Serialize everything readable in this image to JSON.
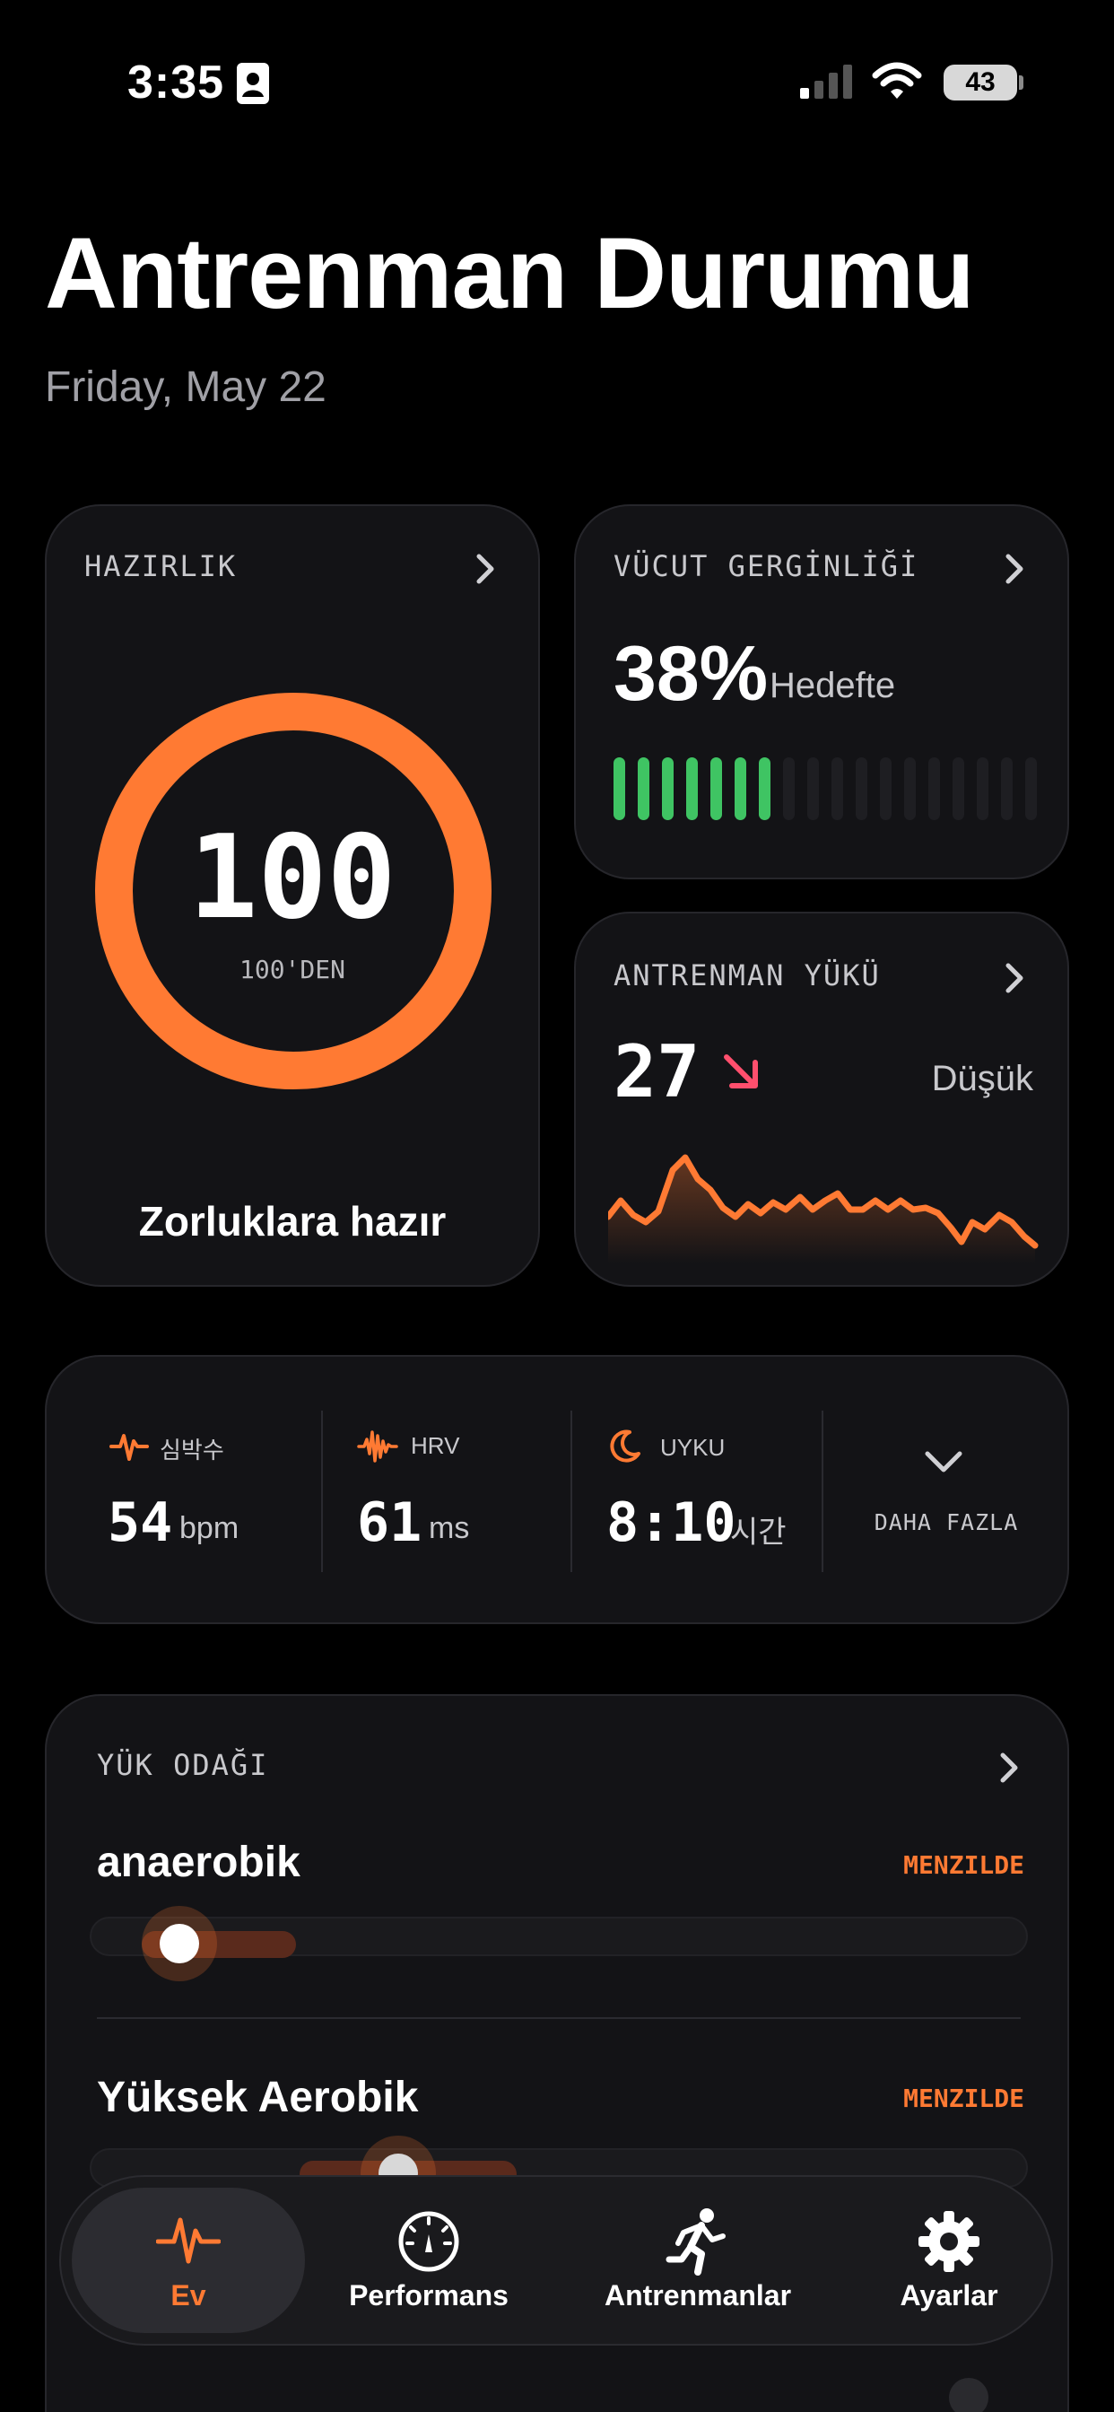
{
  "status_bar": {
    "time": "3:35",
    "battery": "43"
  },
  "header": {
    "title": "Antrenman Durumu",
    "date": "Friday, May 22"
  },
  "readiness": {
    "label": "HAZIRLIK",
    "value": "100",
    "caption": "100'DEN",
    "footer": "Zorluklara hazır",
    "level": 1.0,
    "color": "#ff7a33"
  },
  "body_strain": {
    "label": "VÜCUT GERGİNLİĞİ",
    "value": "38%",
    "status": "Hedefte",
    "filled_segments": 7,
    "total_segments": 18,
    "color": "#3fc463"
  },
  "training_load": {
    "label": "ANTRENMAN YÜKÜ",
    "value": "27",
    "status": "Düşük",
    "trend": "down",
    "trend_color": "#ff4f6d"
  },
  "stats": {
    "heart_rate": {
      "label": "심박수",
      "value": "54",
      "unit": "bpm"
    },
    "hrv": {
      "label": "HRV",
      "value": "61",
      "unit": "ms"
    },
    "sleep": {
      "label": "UYKU",
      "value": "8:10",
      "unit": "시간"
    },
    "more": {
      "label": "DAHA FAZLA"
    }
  },
  "load_focus": {
    "label": "YÜK ODAĞI",
    "items": [
      {
        "name": "anaerobik",
        "status": "MENZILDE"
      },
      {
        "name": "Yüksek Aerobik",
        "status": "MENZILDE"
      }
    ]
  },
  "tabs": [
    {
      "label": "Ev",
      "icon": "heartbeat-icon",
      "active": true
    },
    {
      "label": "Performans",
      "icon": "gauge-icon"
    },
    {
      "label": "Antrenmanlar",
      "icon": "runner-icon"
    },
    {
      "label": "Ayarlar",
      "icon": "gear-icon"
    }
  ],
  "colors": {
    "accent": "#ff7a33",
    "green": "#3fc463",
    "background": "#000000",
    "card": "#131316"
  }
}
